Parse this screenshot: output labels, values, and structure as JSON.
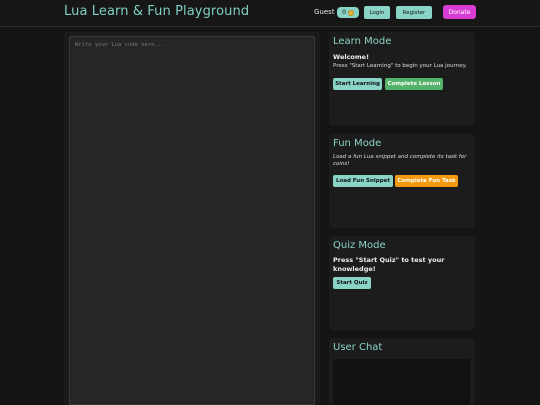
{
  "header": {
    "title": "Lua Learn & Fun Playground",
    "guest": "Guest",
    "coins": "0",
    "coin_icon": "coin-icon",
    "login": "Login",
    "register": "Register",
    "donate": "Donate"
  },
  "editor": {
    "placeholder": "Write your Lua code here...",
    "value": ""
  },
  "learn": {
    "title": "Learn Mode",
    "heading": "Welcome!",
    "text": "Press \"Start Learning\" to begin your Lua journey.",
    "start": "Start Learning",
    "complete": "Complete Lesson"
  },
  "fun": {
    "title": "Fun Mode",
    "text": "Load a fun Lua snippet and complete its task for coins!",
    "load": "Load Fun Snippet",
    "complete": "Complete Fun Task"
  },
  "quiz": {
    "title": "Quiz Mode",
    "text": "Press \"Start Quiz\" to test your knowledge!",
    "start": "Start Quiz"
  },
  "chat": {
    "title": "User Chat"
  },
  "colors": {
    "accent": "#8ad3c7",
    "donate": "#d93cd2",
    "green": "#55b26a",
    "orange": "#f59a0e",
    "background": "#141414"
  }
}
